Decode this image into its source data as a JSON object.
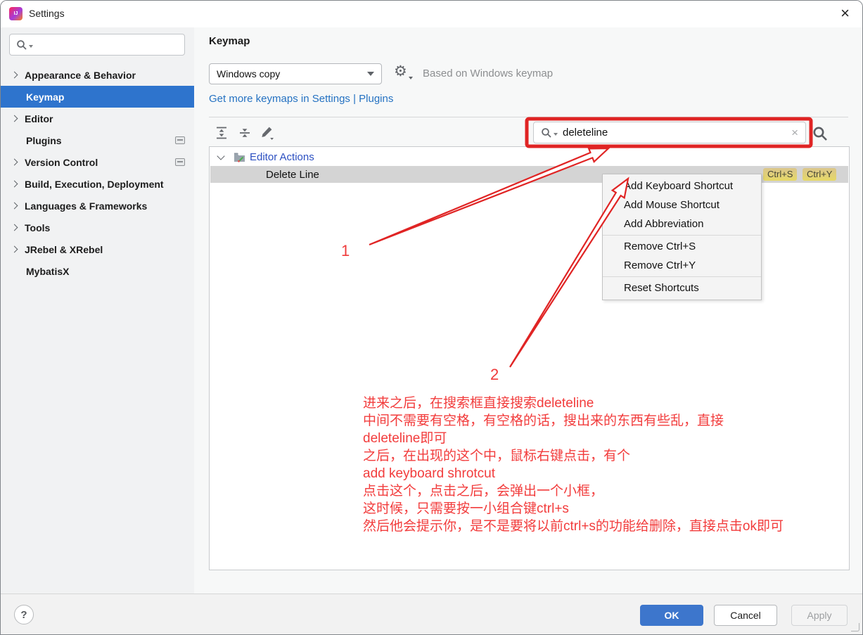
{
  "window": {
    "title": "Settings"
  },
  "icons": {
    "close_glyph": "×",
    "gear_glyph": "⚙",
    "clear_glyph": "×"
  },
  "sidebar": {
    "items": [
      {
        "label": "Appearance & Behavior"
      },
      {
        "label": "Keymap"
      },
      {
        "label": "Editor"
      },
      {
        "label": "Plugins"
      },
      {
        "label": "Version Control"
      },
      {
        "label": "Build, Execution, Deployment"
      },
      {
        "label": "Languages & Frameworks"
      },
      {
        "label": "Tools"
      },
      {
        "label": "JRebel & XRebel"
      },
      {
        "label": "MybatisX"
      }
    ]
  },
  "header": {
    "title": "Keymap",
    "keymap_dropdown_value": "Windows copy",
    "based_on_text": "Based on Windows keymap",
    "get_more_link": "Get more keymaps in Settings | Plugins"
  },
  "actions_toolbar": {
    "search_value": "deleteline"
  },
  "tree": {
    "group": "Editor Actions",
    "selected_action": "Delete Line",
    "shortcut_badges": [
      "Ctrl+S",
      "Ctrl+Y"
    ]
  },
  "context_menu": {
    "items": [
      "Add Keyboard Shortcut",
      "Add Mouse Shortcut",
      "Add Abbreviation",
      "Remove Ctrl+S",
      "Remove Ctrl+Y",
      "Reset Shortcuts"
    ]
  },
  "annotations": {
    "step1_label": "1",
    "step2_label": "2",
    "note_lines": [
      "进来之后，在搜索框直接搜索deleteline",
      "中间不需要有空格，有空格的话，搜出来的东西有些乱，直接",
      "deleteline即可",
      "之后，在出现的这个中，鼠标右键点击，有个",
      "add keyboard shrotcut",
      "点击这个，点击之后，会弹出一个小框，",
      "这时候，只需要按一小组合键ctrl+s",
      "然后他会提示你，是不是要将以前ctrl+s的功能给删除，直接点击ok即可"
    ]
  },
  "footer": {
    "help_label": "?",
    "ok_label": "OK",
    "cancel_label": "Cancel",
    "apply_label": "Apply"
  },
  "colors": {
    "selection_blue": "#2e74cd",
    "link_blue": "#2572c2",
    "annotation_red": "#e02424",
    "selected_row_gray": "#d4d4d4",
    "shortcut_badge_yellow": "#e3d36f",
    "group_label_blue": "#2b4fc1"
  }
}
